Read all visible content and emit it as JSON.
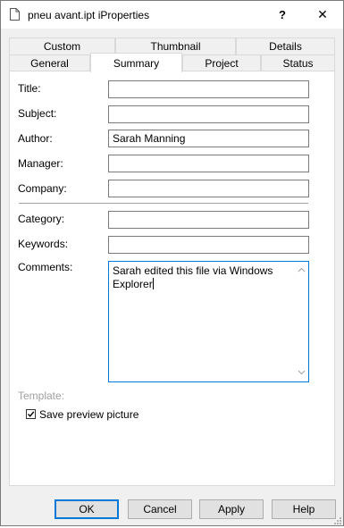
{
  "window": {
    "title": "pneu avant.ipt iProperties",
    "help_label": "?",
    "close_label": "✕"
  },
  "tabs": {
    "back_row": [
      "Custom",
      "Thumbnail",
      "Details"
    ],
    "front_row": [
      "General",
      "Summary",
      "Project",
      "Status"
    ],
    "active": "Summary"
  },
  "fields": {
    "title": {
      "label": "Title:",
      "value": ""
    },
    "subject": {
      "label": "Subject:",
      "value": ""
    },
    "author": {
      "label": "Author:",
      "value": "Sarah Manning"
    },
    "manager": {
      "label": "Manager:",
      "value": ""
    },
    "company": {
      "label": "Company:",
      "value": ""
    },
    "category": {
      "label": "Category:",
      "value": ""
    },
    "keywords": {
      "label": "Keywords:",
      "value": ""
    },
    "comments": {
      "label": "Comments:",
      "value": "Sarah edited this file via Windows Explorer"
    }
  },
  "template": {
    "label": "Template:"
  },
  "save_preview": {
    "label": "Save preview picture",
    "checked": true
  },
  "buttons": {
    "ok": "OK",
    "cancel": "Cancel",
    "apply": "Apply",
    "help": "Help"
  },
  "colors": {
    "accent": "#0078d7",
    "window_bg": "#f0f0f0",
    "disabled_text": "#a0a0a0"
  }
}
